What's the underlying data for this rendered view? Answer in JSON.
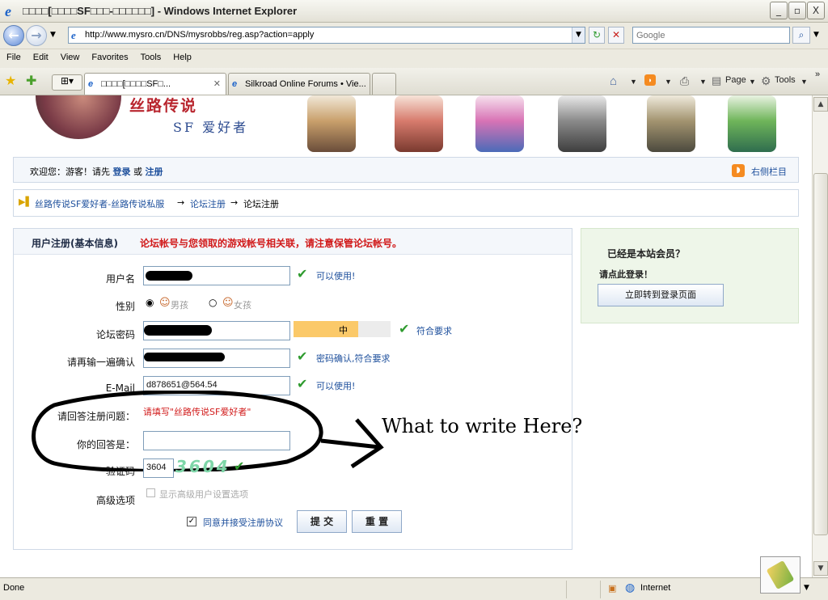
{
  "window": {
    "title": "□□□□[□□□□SF□□□-□□□□□□] - Windows Internet Explorer",
    "min_label": "_",
    "max_label": "▫",
    "close_label": "X"
  },
  "address": {
    "url": "http://www.mysro.cn/DNS/mysrobbs/reg.asp?action=apply",
    "search_placeholder": "Google"
  },
  "menu": [
    "File",
    "Edit",
    "View",
    "Favorites",
    "Tools",
    "Help"
  ],
  "tabs": [
    {
      "label": "□□□□[□□□□SF□...",
      "close": "✕"
    },
    {
      "label": "Silkroad Online Forums • Vie..."
    }
  ],
  "toolbar": {
    "page_label": "Page",
    "tools_label": "Tools"
  },
  "banner": {
    "title": "丝路传说",
    "subtitle": "SF 爱好者"
  },
  "welcome": {
    "text": "欢迎您：游客！请先",
    "login": "登录",
    "or": "或",
    "register": "注册",
    "right_link": "右侧栏目"
  },
  "breadcrumb": {
    "home": "丝路传说SF爱好者-丝路传说私服",
    "arrow": "→",
    "forum_register": "论坛注册",
    "current": "论坛注册"
  },
  "form": {
    "head_bold": "用户注册(基本信息)",
    "head_warn": "论坛帐号与您领取的游戏帐号相关联，请注意保管论坛帐号。",
    "username_label": "用户名",
    "username_ok": "可以使用!",
    "gender_label": "性别",
    "gender_male": "男孩",
    "gender_female": "女孩",
    "password_label": "论坛密码",
    "strength": "中",
    "password_ok": "符合要求",
    "confirm_label": "请再输一遍确认",
    "confirm_ok": "密码确认,符合要求",
    "email_label": "E-Mail",
    "email_value": "d878651@564.54",
    "email_ok": "可以使用!",
    "question_label": "请回答注册问题：",
    "question_text": "请填写\"丝路传说SF爱好者\"",
    "answer_label": "你的回答是：",
    "answer_value": "",
    "annotation": "What to write Here?",
    "captcha_label": "验证码",
    "captcha_value": "3604",
    "captcha_image": "3604",
    "advanced_label": "高级选项",
    "advanced_option": "显示高级用户设置选项",
    "agree_label": "同意并接受注册协议",
    "submit": "提 交",
    "reset": "重 置"
  },
  "side": {
    "title": "已经是本站会员？",
    "subtitle": "请点此登录！",
    "button": "立即转到登录页面"
  },
  "status": {
    "text": "Done",
    "zone": "Internet"
  }
}
